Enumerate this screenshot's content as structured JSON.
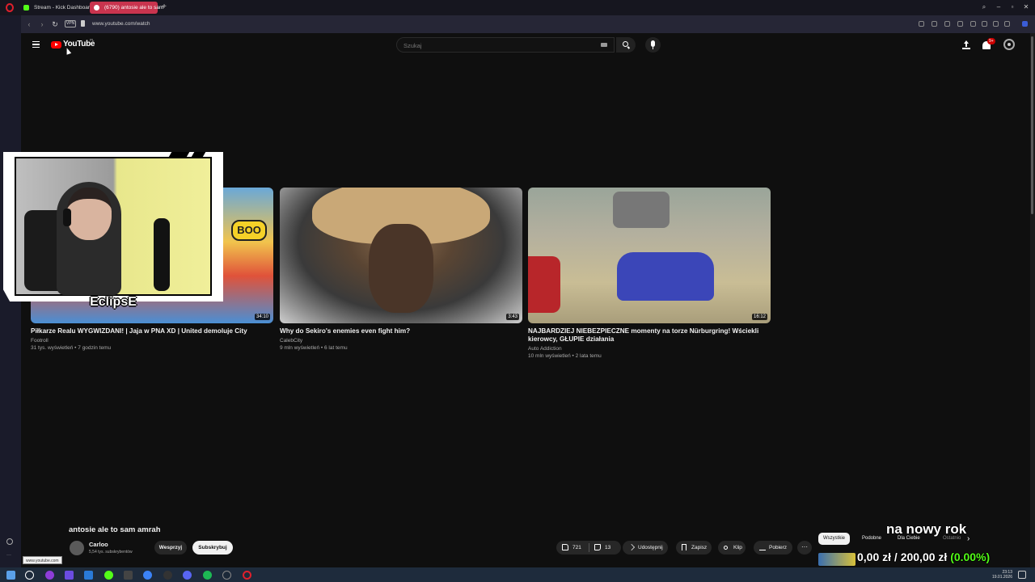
{
  "browser": {
    "tabs": [
      {
        "label": "Stream - Kick Dashboard"
      },
      {
        "label": "(6790) antosie ale to sam"
      }
    ],
    "address": "www.youtube.com/watch",
    "vpn_label": "VPN",
    "status_url": "www.youtube.com"
  },
  "youtube": {
    "logo_text": "YouTube",
    "logo_country": "PL",
    "search_placeholder": "Szukaj",
    "notification_count": "9+",
    "videos": [
      {
        "title": "Piłkarze Realu WYGWIZDANI! | Jaja w PNA XD | United demoluje City",
        "channel": "Footroll",
        "meta": "31 tys. wyświetleń • 7 godzin temu",
        "duration": "34:10",
        "thumb_text": "BOO"
      },
      {
        "title": "Why do Sekiro's enemies even fight him?",
        "channel": "CalebCity",
        "meta": "9 mln wyświetleń • 6 lat temu",
        "duration": "3:43"
      },
      {
        "title": "NAJBARDZIEJ NIEBEZPIECZNE momenty na torze Nürburgring! Wściekli kierowcy, GŁUPIE działania",
        "channel": "Auto Addiction",
        "meta": "10 mln wyświetleń • 2 lata temu",
        "duration": "16:12"
      }
    ],
    "watch": {
      "title": "antosie ale to sam amrah",
      "channel": "Carloo",
      "subscribers": "5,54 tys. subskrybentów",
      "support_label": "Wesprzyj",
      "subscribe_label": "Subskrybuj",
      "likes": "721",
      "dislikes": "13",
      "share_label": "Udostępnij",
      "save_label": "Zapisz",
      "clip_label": "Klip",
      "download_label": "Pobierz",
      "more_label": "···"
    },
    "chips": [
      "Wszystkie",
      "Podobne",
      "Dla Ciebie",
      "Ostatnio"
    ]
  },
  "overlay": {
    "streamer_name": "EclipsE",
    "goal_title": "na nowy rok",
    "goal_amount": "0,00 zł / 200,00 zł",
    "goal_percent": "(0.00%)"
  },
  "taskbar": {
    "time": "23:13",
    "date": "19.01.2026"
  },
  "colors": {
    "youtube_red": "#ff0000",
    "kick_green": "#53fc18",
    "background": "#0f0f0f",
    "active_tab": "#c9344e"
  }
}
